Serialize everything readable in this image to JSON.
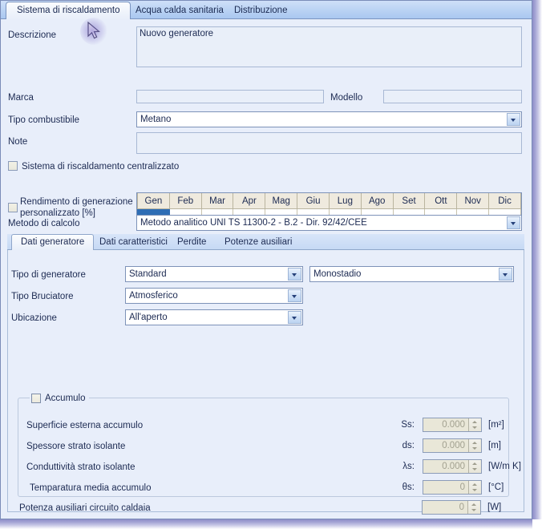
{
  "window": {
    "accent_blue": "#2e6db4",
    "panel_bg": "#e8eefa",
    "tabstrip_bg": "#bcd4f4",
    "border": "#7a8cb8",
    "frame_shadow": "#8e8ec8"
  },
  "top_tabs": [
    {
      "label": "Sistema di riscaldamento",
      "active": true
    },
    {
      "label": "Acqua calda sanitaria",
      "active": false
    },
    {
      "label": "Distribuzione",
      "active": false
    }
  ],
  "form": {
    "descrizione_label": "Descrizione",
    "descrizione_value": "Nuovo generatore",
    "marca_label": "Marca",
    "marca_value": "",
    "modello_label": "Modello",
    "modello_value": "",
    "tipo_combustibile_label": "Tipo combustibile",
    "tipo_combustibile_value": "Metano",
    "note_label": "Note",
    "note_value": "",
    "sistema_centralizzato_label": "Sistema di riscaldamento centralizzato",
    "sistema_centralizzato_checked": false,
    "rendimento_label_line1": "Rendimento di generazione",
    "rendimento_label_line2": "personalizzato [%]",
    "rendimento_checked": false,
    "metodo_label": "Metodo di calcolo",
    "metodo_value": "Metodo analitico UNI TS 11300-2 - B.2 - Dir. 92/42/CEE"
  },
  "month_table": {
    "headers": [
      "Gen",
      "Feb",
      "Mar",
      "Apr",
      "Mag",
      "Giu",
      "Lug",
      "Ago",
      "Set",
      "Ott",
      "Nov",
      "Dic"
    ],
    "values": [
      "",
      "",
      "",
      "",
      "",
      "",
      "",
      "",
      "",
      "",
      "",
      ""
    ],
    "selected_index": 0
  },
  "inner_tabs": [
    {
      "label": "Dati generatore",
      "active": true
    },
    {
      "label": "Dati caratteristici",
      "active": false
    },
    {
      "label": "Perdite",
      "active": false
    },
    {
      "label": "Potenze ausiliari",
      "active": false
    }
  ],
  "generator": {
    "tipo_generatore_label": "Tipo di generatore",
    "tipo_generatore_value": "Standard",
    "stadio_value": "Monostadio",
    "tipo_bruciatore_label": "Tipo Bruciatore",
    "tipo_bruciatore_value": "Atmosferico",
    "ubicazione_label": "Ubicazione",
    "ubicazione_value": "All'aperto"
  },
  "accumulo": {
    "group_label": "Accumulo",
    "enabled": false,
    "rows": [
      {
        "label": "Superficie esterna accumulo",
        "symbol": "Ss:",
        "value": "0.000",
        "unit": "[m²]"
      },
      {
        "label": "Spessore strato isolante",
        "symbol": "ds:",
        "value": "0.000",
        "unit": "[m]"
      },
      {
        "label": "Conduttività strato isolante",
        "symbol": "λs:",
        "value": "0.000",
        "unit": "[W/m K]"
      },
      {
        "label": "Temparatura media accumulo",
        "symbol": "θs:",
        "value": "0",
        "unit": "[°C]"
      },
      {
        "label": "Potenza ausiliari circuito caldaia",
        "symbol": "",
        "value": "0",
        "unit": "[W]"
      }
    ]
  },
  "cursor": {
    "icon": "mouse-pointer-arrow"
  }
}
